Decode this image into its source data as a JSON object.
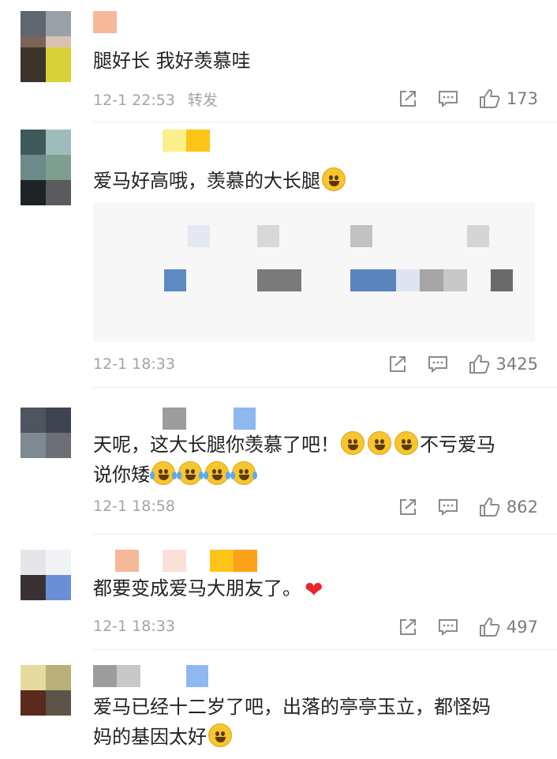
{
  "comments": [
    {
      "text": "腿好长 我好羡慕哇",
      "time": "12-1 22:53",
      "repost": "转发",
      "likes": "173",
      "avatar_colors": [
        "#5e6670",
        "#9aa0a5",
        "#7a6358",
        "#d8c2b4"
      ],
      "avatar_colors2": [
        "#3d332d",
        "#d8d13a"
      ],
      "name_colors": [
        "#f5b899"
      ]
    },
    {
      "text": "爱马好高哦，羡慕的大长腿",
      "emoji": "scared-face",
      "time": "12-1 18:33",
      "likes": "3425",
      "avatar_colors": [
        "#3f5a5a",
        "#9fbcbd",
        "#6c8a87",
        "#7e9e8f",
        "#1f2227",
        "#5a5b5e"
      ],
      "name_colors": [
        "#fbf08a",
        "#fcc417",
        "#fcb21f"
      ]
    },
    {
      "text_line1": "天呢，这大长腿你羡慕了吧！",
      "text_tail1": "不亏爱马",
      "text_line2": "说你矮",
      "time": "12-1 18:58",
      "likes": "862",
      "avatar_colors": [
        "#4e5560",
        "#3f4450",
        "#7e8a92",
        "#6c7074"
      ],
      "name_colors": [
        "#9d9d9d",
        "#8fb7f2"
      ]
    },
    {
      "text": "都要变成爱马大朋友了。",
      "time": "12-1 18:33",
      "likes": "497",
      "avatar_colors": [
        "#e5e5ea",
        "#f2f3f6",
        "#3a3136",
        "#6a8fd6"
      ],
      "name_colors": [
        "#f5b899",
        "#fbe0d8",
        "#fcc417",
        "#fca11a"
      ]
    },
    {
      "text_line1": "爱马已经十二岁了吧，出落的亭亭玉立，都怪妈",
      "text_line2": "妈的基因太好",
      "avatar_colors": [
        "#e6db9e",
        "#b9b07a",
        "#5a2a1f",
        "#5b5448"
      ],
      "name_colors": [
        "#9d9d9d",
        "#c8c8c8",
        "#8fb7f2"
      ]
    }
  ],
  "icons": {
    "share": "share-icon",
    "comment": "comment-icon",
    "like": "thumbs-up-icon"
  }
}
